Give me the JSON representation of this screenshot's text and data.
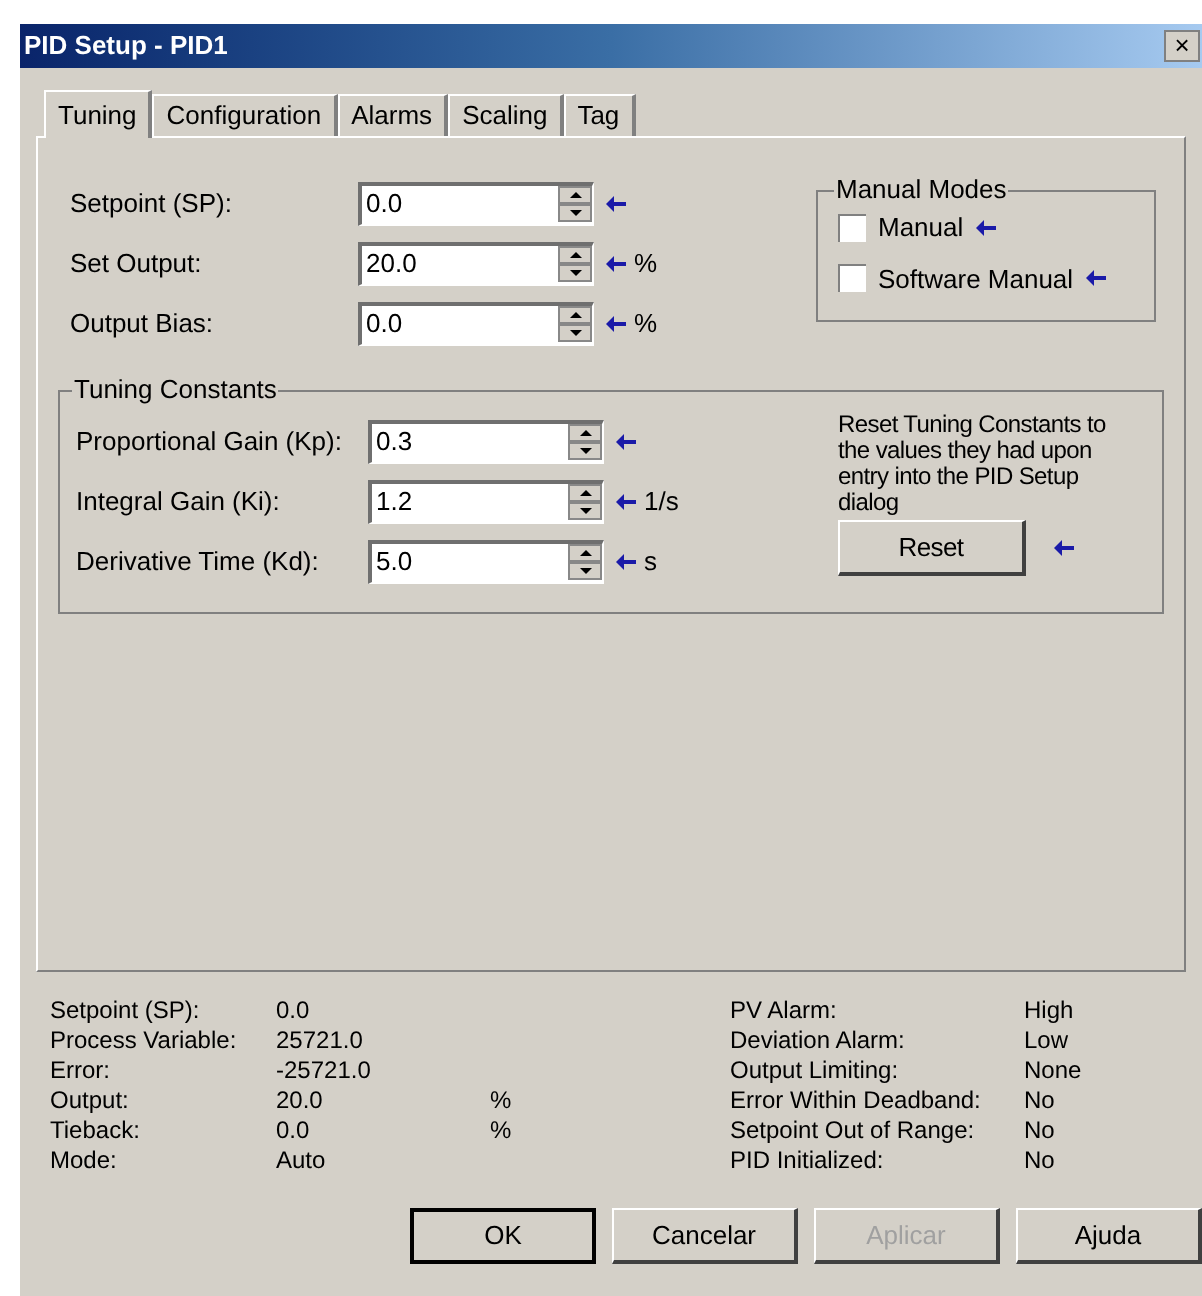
{
  "window": {
    "title": "PID Setup - PID1",
    "close": "×"
  },
  "tabs": [
    {
      "label": "Tuning",
      "selected": true
    },
    {
      "label": "Configuration",
      "selected": false
    },
    {
      "label": "Alarms",
      "selected": false
    },
    {
      "label": "Scaling",
      "selected": false
    },
    {
      "label": "Tag",
      "selected": false
    }
  ],
  "fields": [
    {
      "label": "Setpoint (SP):",
      "value": "0.0"
    },
    {
      "label": "Set Output:",
      "value": "20.0",
      "unit": "%"
    },
    {
      "label": "Output Bias:",
      "value": "0.0",
      "unit": "%"
    }
  ],
  "manual_modes": {
    "title": "Manual Modes",
    "options": [
      {
        "label": "Manual",
        "checked": false
      },
      {
        "label": "Software Manual",
        "checked": false
      }
    ]
  },
  "tuning_constants": {
    "title": "Tuning Constants",
    "fields": [
      {
        "label": "Proportional Gain (Kp):",
        "value": "0.3"
      },
      {
        "label": "Integral Gain (Ki):",
        "value": "1.2",
        "unit": "1/s"
      },
      {
        "label": "Derivative Time (Kd):",
        "value": "5.0",
        "unit": "s"
      }
    ],
    "reset_note": "Reset Tuning Constants to the values they had upon entry into the PID Setup dialog",
    "reset_button": "Reset"
  },
  "status_left": [
    {
      "label": "Setpoint (SP):",
      "value": "0.0"
    },
    {
      "label": "Process Variable:",
      "value": "25721.0"
    },
    {
      "label": "Error:",
      "value": "-25721.0"
    },
    {
      "label": "Output:",
      "value": "20.0",
      "unit": "%"
    },
    {
      "label": "Tieback:",
      "value": "0.0",
      "unit": "%"
    },
    {
      "label": "Mode:",
      "value": "Auto"
    }
  ],
  "status_right": [
    {
      "label": "PV Alarm:",
      "value": "High"
    },
    {
      "label": "Deviation Alarm:",
      "value": "Low"
    },
    {
      "label": "Output Limiting:",
      "value": "None"
    },
    {
      "label": "Error Within Deadband:",
      "value": "No"
    },
    {
      "label": "Setpoint Out of Range:",
      "value": "No"
    },
    {
      "label": "PID Initialized:",
      "value": "No"
    }
  ],
  "buttons": [
    {
      "label": "OK",
      "disabled": false
    },
    {
      "label": "Cancelar",
      "disabled": false
    },
    {
      "label": "Aplicar",
      "disabled": true
    },
    {
      "label": "Ajuda",
      "disabled": false
    }
  ]
}
